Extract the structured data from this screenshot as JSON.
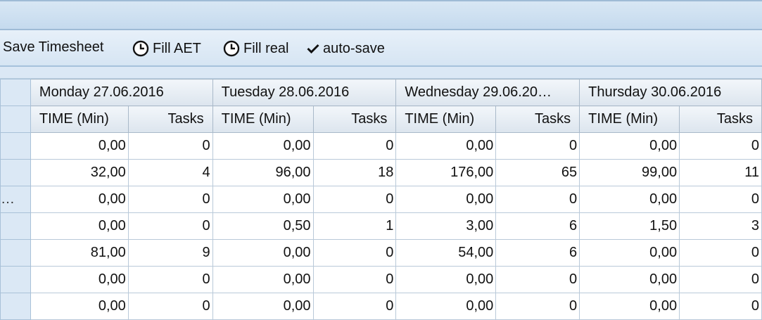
{
  "toolbar": {
    "save_label": "Save Timesheet",
    "fill_aet_label": "Fill AET",
    "fill_real_label": "Fill real",
    "autosave_label": "auto-save"
  },
  "table": {
    "days": [
      "Monday 27.06.2016",
      "Tuesday 28.06.2016",
      "Wednesday 29.06.20…",
      "Thursday 30.06.2016"
    ],
    "sub_headers": {
      "time": "TIME (Min)",
      "tasks": "Tasks"
    },
    "row_labels": [
      "",
      "",
      "…",
      "",
      "",
      "",
      ""
    ],
    "rows": [
      [
        "0,00",
        "0",
        "0,00",
        "0",
        "0,00",
        "0",
        "0,00",
        "0"
      ],
      [
        "32,00",
        "4",
        "96,00",
        "18",
        "176,00",
        "65",
        "99,00",
        "11"
      ],
      [
        "0,00",
        "0",
        "0,00",
        "0",
        "0,00",
        "0",
        "0,00",
        "0"
      ],
      [
        "0,00",
        "0",
        "0,50",
        "1",
        "3,00",
        "6",
        "1,50",
        "3"
      ],
      [
        "81,00",
        "9",
        "0,00",
        "0",
        "54,00",
        "6",
        "0,00",
        "0"
      ],
      [
        "0,00",
        "0",
        "0,00",
        "0",
        "0,00",
        "0",
        "0,00",
        "0"
      ],
      [
        "0,00",
        "0",
        "0,00",
        "0",
        "0,00",
        "0",
        "0,00",
        "0"
      ]
    ]
  },
  "icons": {
    "fill_aet": "clock-icon",
    "fill_real": "clock-icon",
    "autosave": "checkmark-icon"
  }
}
